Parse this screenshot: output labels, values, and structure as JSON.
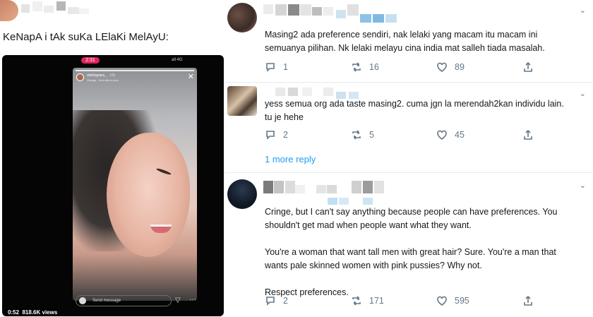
{
  "left": {
    "tweet_text": "KeNapA i tAk suKa LElaKi MelAyU:",
    "video": {
      "timer": "2:31",
      "status": "all 4G",
      "story_user": "darlingsara_",
      "story_age": "10h",
      "story_sub": "Orange · from album pics",
      "send_placeholder": "Send message",
      "elapsed": "0:52",
      "views": "818.6K views"
    }
  },
  "replies": [
    {
      "text": "Masing2 ada preference sendiri, nak lelaki yang macam itu macam ini\nsemuanya pilihan. Nk lelaki melayu cina india mat salleh tiada masalah.",
      "replies_count": "1",
      "retweets_count": "16",
      "likes_count": "89"
    },
    {
      "text": "yess semua org ada taste masing2. cuma jgn la merendah2kan individu lain.\ntu je hehe",
      "replies_count": "2",
      "retweets_count": "5",
      "likes_count": "45"
    },
    {
      "text": "Cringe, but I can't say anything because people can have preferences. You\nshouldn't get mad when people want what they want.\n\nYou're a woman that want tall men with great hair? Sure. You're a man that\nwants pale skinned women with pink pussies? Why not.\n\nRespect preferences.",
      "replies_count": "2",
      "retweets_count": "171",
      "likes_count": "595"
    }
  ],
  "more_replies_label": "1 more reply",
  "icons": {
    "reply": "reply-icon",
    "retweet": "retweet-icon",
    "like": "heart-icon",
    "share": "share-icon",
    "menu": "chevron-down-icon"
  },
  "colors": {
    "link": "#1da1f2",
    "muted": "#657786",
    "separator": "#e6ecf0"
  }
}
